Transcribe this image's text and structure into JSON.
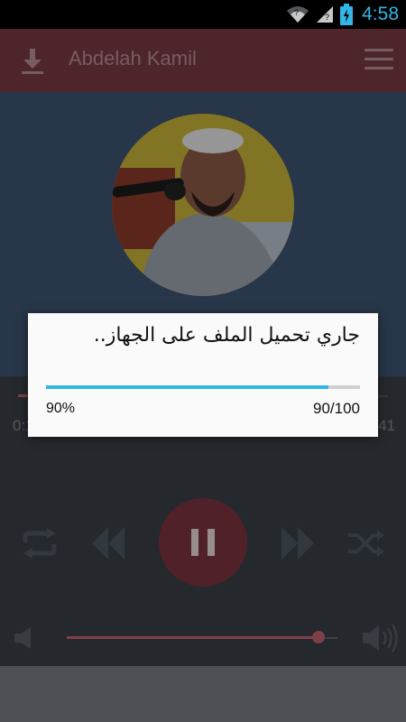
{
  "status_bar": {
    "time": "4:58",
    "icons": [
      "wifi-icon",
      "signal-icon",
      "battery-charging-icon"
    ]
  },
  "app_bar": {
    "title": "Abdelah Kamil",
    "left_icon": "download-icon",
    "right_icon": "menu-icon"
  },
  "player": {
    "time_elapsed": "0:1",
    "time_total": "41",
    "volume_level": 0.93,
    "icons": [
      "repeat-icon",
      "previous-icon",
      "pause-icon",
      "next-icon",
      "shuffle-icon",
      "volume-low-icon",
      "volume-high-icon"
    ]
  },
  "dialog": {
    "message": "جاري تحميل الملف على الجهاز..",
    "progress": 0.9,
    "percent_text": "90%",
    "count_text": "90/100"
  },
  "colors": {
    "accent": "#33b5e5",
    "app_bar": "#7a3a44",
    "play_button": "#7d3440",
    "slider": "#c0636f"
  }
}
